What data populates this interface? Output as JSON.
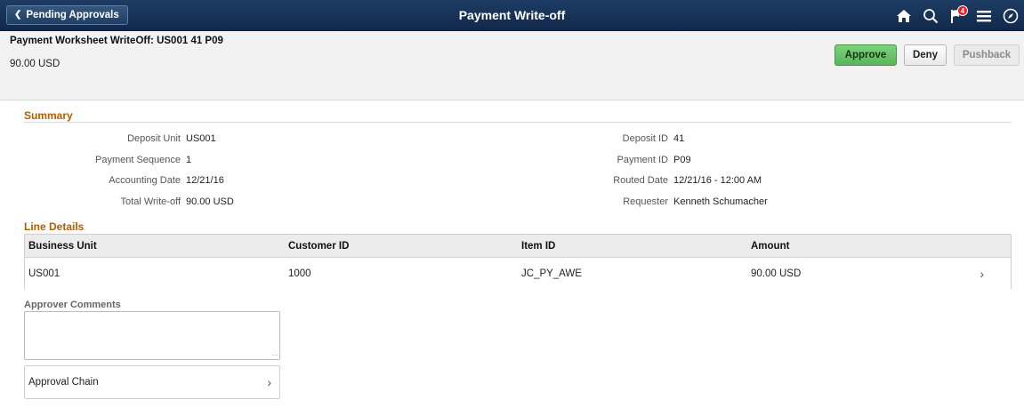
{
  "banner": {
    "back_label": "Pending Approvals",
    "title": "Payment Write-off",
    "icons": [
      "home-icon",
      "search-icon",
      "notification-flag-icon",
      "menu-icon",
      "navbar-compass-icon"
    ],
    "notification_count": "4"
  },
  "header": {
    "title": "Payment Worksheet WriteOff:  US001  41  P09",
    "amount": "90.00  USD",
    "buttons": {
      "approve": "Approve",
      "deny": "Deny",
      "pushback": "Pushback"
    }
  },
  "summary": {
    "title": "Summary",
    "left": [
      {
        "label": "Deposit Unit",
        "value": "US001"
      },
      {
        "label": "Payment Sequence",
        "value": "1"
      },
      {
        "label": "Accounting Date",
        "value": "12/21/16"
      },
      {
        "label": "Total Write-off",
        "value": "90.00  USD"
      }
    ],
    "right": [
      {
        "label": "Deposit ID",
        "value": "41"
      },
      {
        "label": "Payment ID",
        "value": "P09"
      },
      {
        "label": "Routed Date",
        "value": "12/21/16 - 12:00 AM"
      },
      {
        "label": "Requester",
        "value": "Kenneth Schumacher"
      }
    ]
  },
  "line_details": {
    "title": "Line Details",
    "columns": [
      "Business Unit",
      "Customer ID",
      "Item ID",
      "Amount"
    ],
    "rows": [
      [
        "US001",
        "1000",
        "JC_PY_AWE",
        "90.00 USD"
      ]
    ]
  },
  "comments": {
    "label": "Approver Comments",
    "value": ""
  },
  "approval_chain": {
    "label": "Approval Chain"
  },
  "colors": {
    "banner": "#1e3c64",
    "section_title": "#b35c00",
    "approve": "#6cc36c"
  }
}
